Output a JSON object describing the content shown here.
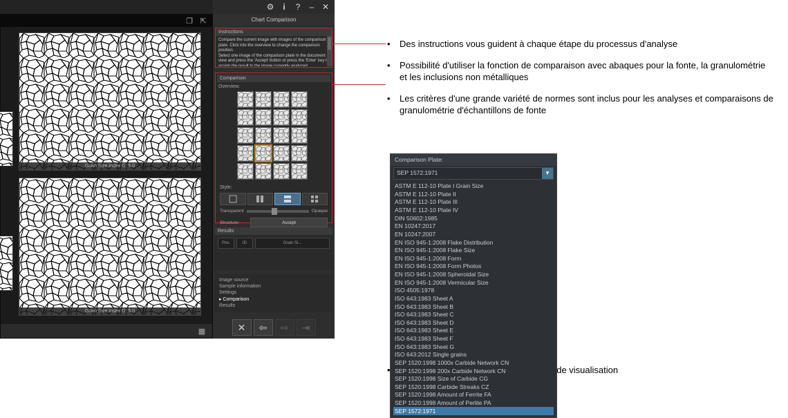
{
  "app": {
    "panel_title": "Chart Comparison",
    "instructions": {
      "header": "Instructions",
      "line1": "Compare the current image with images of the comparison plate. Click into the overview to change the comparison position.",
      "line2": "Select one image of the comparison plate in the document view and press the 'Accept' button or press the 'Enter' key to assign the result to the image currently analyzed."
    },
    "comparison": {
      "header": "Comparison",
      "overview_label": "Overview:",
      "style_label": "Style:",
      "slider_left": "Transparent",
      "slider_right": "Opaque",
      "structure_label": "Structure:",
      "accept_btn": "Accept"
    },
    "results": {
      "header": "Results",
      "col_pos": "Pos.",
      "col_id": "ID",
      "col_grainsize": "Grain Si..."
    },
    "thumbs": {
      "cap1": "Grain Size index G: 5.0",
      "cap2": "Grain Size index G: 5.0"
    },
    "nav": {
      "items": [
        "Image source",
        "Sample information",
        "Settings",
        "Comparison",
        "Results"
      ],
      "selected_index": 3
    }
  },
  "callouts": {
    "c1": "Des instructions vous guident à chaque étape du processus d'analyse",
    "c2": "Possibilité d'utiliser la fonction de comparaison avec abaques pour la fonte, la granulométrie et les inclusions non métalliques",
    "c3": "Les critères d'une grande variété de normes sont inclus pour les analyses et comparaisons de granulométrie d'échantillons de fonte",
    "c4": "Possibilité d'ajuster la plaque et le type de visualisation"
  },
  "dropdown": {
    "header": "Comparison Plate:",
    "selected": "SEP 1572:1971",
    "items": [
      "ASTM E 112-10 Plate I Grain Size",
      "ASTM E 112-10 Plate II",
      "ASTM E 112-10 Plate III",
      "ASTM E 112-10 Plate IV",
      "DIN 50602:1985",
      "EN 10247:2017",
      "EN 10247:2007",
      "EN ISO 945-1:2008 Flake Distribution",
      "EN ISO 945-1:2008 Flake Size",
      "EN ISO 945-1:2008 Form",
      "EN ISO 945-1:2008 Form Photos",
      "EN ISO 945-1:2008 Spheroidal Size",
      "EN ISO 945-1:2008 Vermicular Size",
      "ISO 4505:1978",
      "ISO 643:1983 Sheet A",
      "ISO 643:1983 Sheet B",
      "ISO 643:1983 Sheet C",
      "ISO 643:1983 Sheet D",
      "ISO 643:1983 Sheet E",
      "ISO 643:1983 Sheet F",
      "ISO 643:1983 Sheet G",
      "ISO 643:2012 Single grains",
      "SEP 1520:1998 1000x Carbide Network CN",
      "SEP 1520:1998 200x Carbide Network CN",
      "SEP 1520:1998 Size of Carbide CG",
      "SEP 1520:1998 Carbide Streaks CZ",
      "SEP 1520:1998 Amount of Ferrite FA",
      "SEP 1520:1998 Amount of Perlite PA",
      "SEP 1572:1971"
    ]
  }
}
